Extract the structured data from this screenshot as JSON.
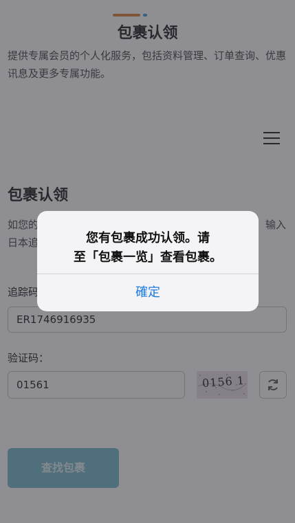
{
  "header": {
    "title": "包裹认领"
  },
  "intro_text": "提供专属会员的个人化服务，包括资料管理、订单查询、优惠讯息及更多专属功能。",
  "section": {
    "title": "包裹认领",
    "desc_visible_left": "如您的",
    "desc_visible_right": "输入",
    "desc_line2": "日本追"
  },
  "form": {
    "tracking_label": "追踪码",
    "tracking_value": "ER1746916935",
    "verify_label": "验证码：",
    "verify_value": "01561",
    "captcha_text": "0156 1",
    "search_button": "查找包裹"
  },
  "dialog": {
    "message_line1": "您有包裹成功认领。请",
    "message_line2": "至「包裹一览」查看包裹。",
    "ok_label": "確定"
  },
  "colors": {
    "accent_orange": "#e08a4a",
    "accent_blue": "#4aa3df",
    "button": "#7fc1cf",
    "link": "#1a7ae0"
  }
}
